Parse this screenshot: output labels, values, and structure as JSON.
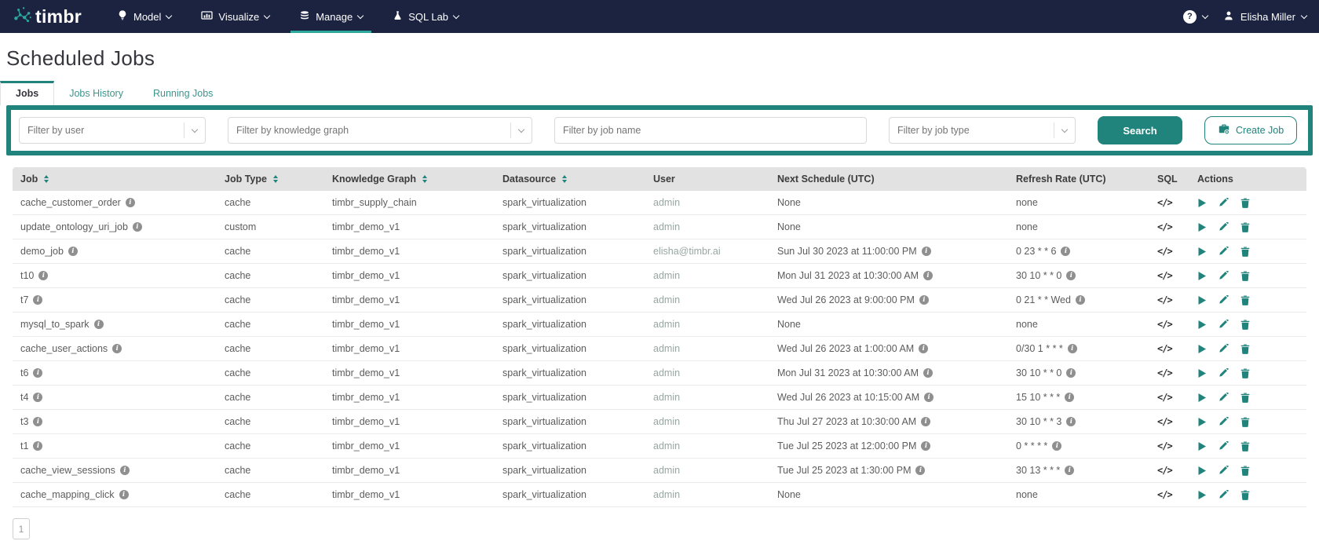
{
  "brand": {
    "name": "timbr"
  },
  "navbar": {
    "items": [
      {
        "label": "Model",
        "icon": "lightbulb-icon",
        "active": false
      },
      {
        "label": "Visualize",
        "icon": "chart-icon",
        "active": false
      },
      {
        "label": "Manage",
        "icon": "database-icon",
        "active": true
      },
      {
        "label": "SQL Lab",
        "icon": "flask-icon",
        "active": false
      }
    ],
    "help_label": "?",
    "user": {
      "name": "Elisha Miller"
    }
  },
  "page": {
    "title": "Scheduled Jobs"
  },
  "tabs": [
    {
      "label": "Jobs",
      "active": true
    },
    {
      "label": "Jobs History",
      "active": false
    },
    {
      "label": "Running Jobs",
      "active": false
    }
  ],
  "filters": {
    "user_placeholder": "Filter by user",
    "kg_placeholder": "Filter by knowledge graph",
    "job_name_placeholder": "Filter by job name",
    "job_type_placeholder": "Filter by job type",
    "search_label": "Search",
    "create_job_label": "Create Job"
  },
  "table": {
    "columns": [
      {
        "label": "Job",
        "sortable": true
      },
      {
        "label": "Job Type",
        "sortable": true
      },
      {
        "label": "Knowledge Graph",
        "sortable": true
      },
      {
        "label": "Datasource",
        "sortable": true
      },
      {
        "label": "User",
        "sortable": false
      },
      {
        "label": "Next Schedule (UTC)",
        "sortable": false
      },
      {
        "label": "Refresh Rate (UTC)",
        "sortable": false
      },
      {
        "label": "SQL",
        "sortable": false
      },
      {
        "label": "Actions",
        "sortable": false
      }
    ],
    "rows": [
      {
        "job": "cache_customer_order",
        "job_type": "cache",
        "knowledge_graph": "timbr_supply_chain",
        "datasource": "spark_virtualization",
        "user": "admin",
        "next_schedule": "None",
        "refresh_rate": "none"
      },
      {
        "job": "update_ontology_uri_job",
        "job_type": "custom",
        "knowledge_graph": "timbr_demo_v1",
        "datasource": "spark_virtualization",
        "user": "admin",
        "next_schedule": "None",
        "refresh_rate": "none"
      },
      {
        "job": "demo_job",
        "job_type": "cache",
        "knowledge_graph": "timbr_demo_v1",
        "datasource": "spark_virtualization",
        "user": "elisha@timbr.ai",
        "next_schedule": "Sun Jul 30 2023 at 11:00:00 PM",
        "refresh_rate": "0 23 * * 6"
      },
      {
        "job": "t10",
        "job_type": "cache",
        "knowledge_graph": "timbr_demo_v1",
        "datasource": "spark_virtualization",
        "user": "admin",
        "next_schedule": "Mon Jul 31 2023 at 10:30:00 AM",
        "refresh_rate": "30 10 * * 0"
      },
      {
        "job": "t7",
        "job_type": "cache",
        "knowledge_graph": "timbr_demo_v1",
        "datasource": "spark_virtualization",
        "user": "admin",
        "next_schedule": "Wed Jul 26 2023 at 9:00:00 PM",
        "refresh_rate": "0 21 * * Wed"
      },
      {
        "job": "mysql_to_spark",
        "job_type": "cache",
        "knowledge_graph": "timbr_demo_v1",
        "datasource": "spark_virtualization",
        "user": "admin",
        "next_schedule": "None",
        "refresh_rate": "none"
      },
      {
        "job": "cache_user_actions",
        "job_type": "cache",
        "knowledge_graph": "timbr_demo_v1",
        "datasource": "spark_virtualization",
        "user": "admin",
        "next_schedule": "Wed Jul 26 2023 at 1:00:00 AM",
        "refresh_rate": "0/30 1 * * *"
      },
      {
        "job": "t6",
        "job_type": "cache",
        "knowledge_graph": "timbr_demo_v1",
        "datasource": "spark_virtualization",
        "user": "admin",
        "next_schedule": "Mon Jul 31 2023 at 10:30:00 AM",
        "refresh_rate": "30 10 * * 0"
      },
      {
        "job": "t4",
        "job_type": "cache",
        "knowledge_graph": "timbr_demo_v1",
        "datasource": "spark_virtualization",
        "user": "admin",
        "next_schedule": "Wed Jul 26 2023 at 10:15:00 AM",
        "refresh_rate": "15 10 * * *"
      },
      {
        "job": "t3",
        "job_type": "cache",
        "knowledge_graph": "timbr_demo_v1",
        "datasource": "spark_virtualization",
        "user": "admin",
        "next_schedule": "Thu Jul 27 2023 at 10:30:00 AM",
        "refresh_rate": "30 10 * * 3"
      },
      {
        "job": "t1",
        "job_type": "cache",
        "knowledge_graph": "timbr_demo_v1",
        "datasource": "spark_virtualization",
        "user": "admin",
        "next_schedule": "Tue Jul 25 2023 at 12:00:00 PM",
        "refresh_rate": "0 * * * *"
      },
      {
        "job": "cache_view_sessions",
        "job_type": "cache",
        "knowledge_graph": "timbr_demo_v1",
        "datasource": "spark_virtualization",
        "user": "admin",
        "next_schedule": "Tue Jul 25 2023 at 1:30:00 PM",
        "refresh_rate": "30 13 * * *"
      },
      {
        "job": "cache_mapping_click",
        "job_type": "cache",
        "knowledge_graph": "timbr_demo_v1",
        "datasource": "spark_virtualization",
        "user": "admin",
        "next_schedule": "None",
        "refresh_rate": "none"
      }
    ]
  },
  "pagination": {
    "pages": [
      "1"
    ]
  },
  "colors": {
    "navbar_bg": "#1c2340",
    "accent_teal": "#20837c",
    "logo_teal": "#2ca89c",
    "header_gray": "#e2e2e2",
    "muted_user": "#97a6a2"
  }
}
